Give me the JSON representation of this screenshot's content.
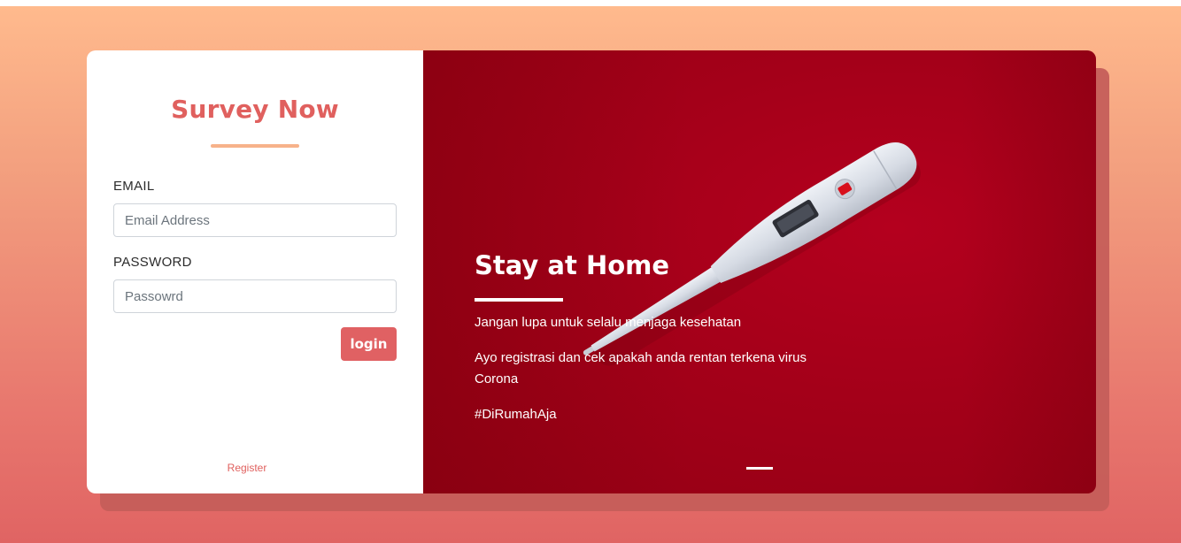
{
  "brand": {
    "title": "Survey Now"
  },
  "login_form": {
    "email_label": "EMAIL",
    "email_placeholder": "Email Address",
    "email_value": "",
    "password_label": "PASSWORD",
    "password_placeholder": "Passowrd",
    "password_value": "",
    "login_button": "login",
    "register_link": "Register"
  },
  "hero": {
    "title": "Stay at Home",
    "line1": "Jangan lupa untuk selalu menjaga kesehatan",
    "line2": "Ayo registrasi dan cek apakah anda rentan terkena virus Corona",
    "hashtag": "#DiRumahAja",
    "image_icon": "thermometer-image"
  },
  "colors": {
    "accent": "#e0605e",
    "button": "#e06163",
    "underline": "#f7b28a",
    "hero_red": "#a40019",
    "page_gradient_top": "#ffba8d",
    "page_gradient_bottom": "#e06463"
  }
}
